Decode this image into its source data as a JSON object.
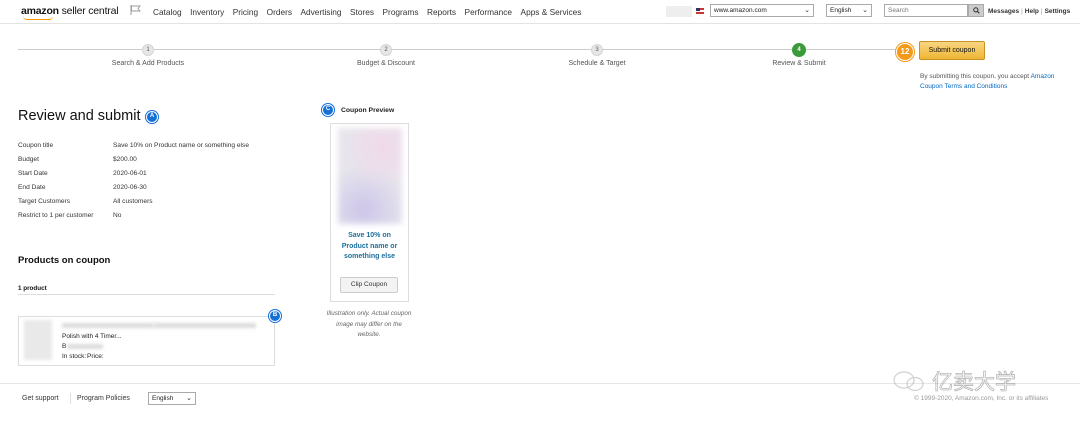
{
  "header": {
    "logo_brand": "amazon",
    "logo_sub": "seller central",
    "nav": [
      "Catalog",
      "Inventory",
      "Pricing",
      "Orders",
      "Advertising",
      "Stores",
      "Programs",
      "Reports",
      "Performance",
      "Apps & Services"
    ],
    "marketplace": "www.amazon.com",
    "language": "English",
    "search_placeholder": "Search",
    "links": [
      "Messages",
      "Help",
      "Settings"
    ]
  },
  "stepper": {
    "steps": [
      {
        "num": "1",
        "label": "Search & Add Products"
      },
      {
        "num": "2",
        "label": "Budget & Discount"
      },
      {
        "num": "3",
        "label": "Schedule & Target"
      },
      {
        "num": "4",
        "label": "Review & Submit"
      }
    ],
    "active_step": 4
  },
  "actions": {
    "badge": "12",
    "submit_label": "Submit coupon",
    "terms_prefix": "By submitting this coupon, you accept ",
    "terms_link": "Amazon Coupon Terms and Conditions"
  },
  "review": {
    "title": "Review and submit",
    "marker": "A",
    "details": [
      {
        "label": "Coupon title",
        "value": "Save 10% on Product name or something else"
      },
      {
        "label": "Budget",
        "value": "$200.00"
      },
      {
        "label": "Start Date",
        "value": "2020-06-01"
      },
      {
        "label": "End Date",
        "value": "2020-06-30"
      },
      {
        "label": "Target Customers",
        "value": "All customers"
      },
      {
        "label": "Restrict to 1 per customer",
        "value": "No"
      }
    ]
  },
  "products": {
    "title": "Products on coupon",
    "count": "1 product",
    "marker": "B",
    "item": {
      "name": "Polish with 4 Timer...",
      "asin_prefix": "B",
      "stock_label": "In stock:",
      "price_label": "Price:"
    }
  },
  "preview": {
    "marker": "C",
    "title": "Coupon Preview",
    "coupon_text": "Save 10% on Product name or something else",
    "clip_label": "Clip Coupon",
    "disclaimer": "Illustration only. Actual coupon image may differ on the website."
  },
  "footer": {
    "support": "Get support",
    "policies": "Program Policies",
    "language": "English",
    "copyright": "© 1999-2020, Amazon.com, Inc. or its affiliates",
    "watermark": "亿卖大学"
  },
  "colors": {
    "accent_blue": "#1570d6",
    "step_active": "#3b9b3b",
    "submit_yellow": "#efb534",
    "badge_orange": "#f39a1b",
    "link": "#0066c0"
  }
}
